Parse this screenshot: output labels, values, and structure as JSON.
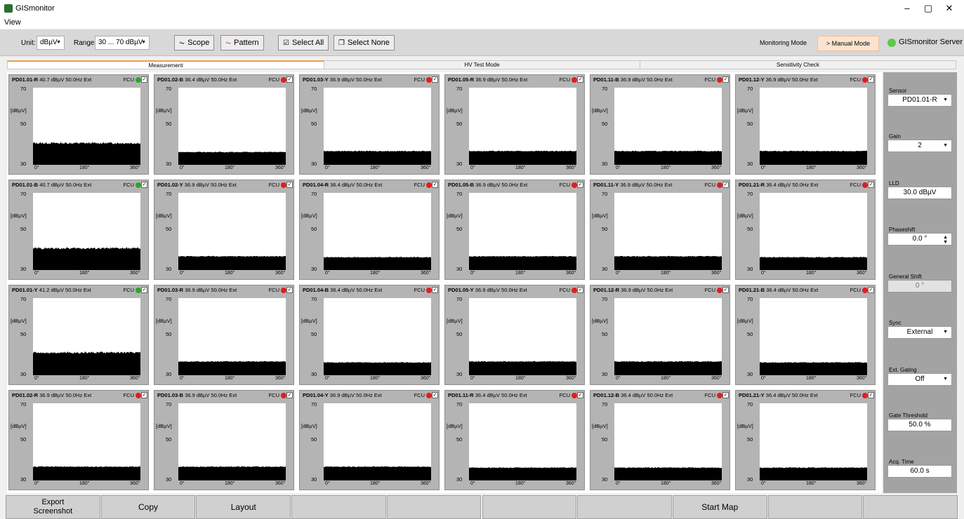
{
  "window": {
    "title": "GISmonitor",
    "minimize": "–",
    "maximize": "▢",
    "close": "✕"
  },
  "menu": {
    "view": "View"
  },
  "toolbar": {
    "unit_label": "Unit:",
    "unit_value": "dBµV",
    "range_label": "Range:",
    "range_value": "30 ... 70 dBµV",
    "scope": "Scope",
    "pattern": "Pattern",
    "select_all": "Select All",
    "select_none": "Select None",
    "monitoring_mode": "Monitoring Mode",
    "manual_mode": "> Manual Mode",
    "server": "GISmonitor Server"
  },
  "tabs": [
    "Measurement",
    "HV Test Mode",
    "Sensitivity Check"
  ],
  "plot_axis": {
    "y_max": "70",
    "y_unit": "[dBµV]",
    "y_mid": "50",
    "y_min": "30",
    "x0": "0°",
    "x1": "180°",
    "x2": "360°"
  },
  "colors": {
    "ok": "#28a828",
    "alarm": "#e01e1e"
  },
  "panels": [
    {
      "id": "PD01.01-R",
      "info": "40.7 dBµV 50.0Hz Ext",
      "fcu": "FCU",
      "status": "ok",
      "level": 40.7
    },
    {
      "id": "PD01.02-B",
      "info": "36.4 dBµV 50.0Hz Ext",
      "fcu": "FCU",
      "status": "alarm",
      "level": 36.4
    },
    {
      "id": "PD01.03-Y",
      "info": "36.9 dBµV 50.0Hz Ext",
      "fcu": "FCU",
      "status": "alarm",
      "level": 36.9
    },
    {
      "id": "PD01.05-R",
      "info": "36.9 dBµV 50.0Hz Ext",
      "fcu": "FCU",
      "status": "alarm",
      "level": 36.9
    },
    {
      "id": "PD01.11-B",
      "info": "36.9 dBµV 50.0Hz Ext",
      "fcu": "FCU",
      "status": "alarm",
      "level": 36.9
    },
    {
      "id": "PD01.12-Y",
      "info": "36.9 dBµV 50.0Hz Ext",
      "fcu": "FCU",
      "status": "alarm",
      "level": 36.9
    },
    {
      "id": "PD01.01-B",
      "info": "40.7 dBµV 50.0Hz Ext",
      "fcu": "FCU",
      "status": "ok",
      "level": 40.7
    },
    {
      "id": "PD01.02-Y",
      "info": "36.9 dBµV 50.0Hz Ext",
      "fcu": "FCU",
      "status": "alarm",
      "level": 36.9
    },
    {
      "id": "PD01.04-R",
      "info": "36.4 dBµV 50.0Hz Ext",
      "fcu": "FCU",
      "status": "alarm",
      "level": 36.4
    },
    {
      "id": "PD01.05-B",
      "info": "36.9 dBµV 50.0Hz Ext",
      "fcu": "FCU",
      "status": "alarm",
      "level": 36.9
    },
    {
      "id": "PD01.11-Y",
      "info": "36.9 dBµV 50.0Hz Ext",
      "fcu": "FCU",
      "status": "alarm",
      "level": 36.9
    },
    {
      "id": "PD01.21-R",
      "info": "36.4 dBµV 50.0Hz Ext",
      "fcu": "FCU",
      "status": "alarm",
      "level": 36.4
    },
    {
      "id": "PD01.01-Y",
      "info": "41.2 dBµV 50.0Hz Ext",
      "fcu": "FCU",
      "status": "ok",
      "level": 41.2
    },
    {
      "id": "PD01.03-R",
      "info": "36.9 dBµV 50.0Hz Ext",
      "fcu": "FCU",
      "status": "alarm",
      "level": 36.9
    },
    {
      "id": "PD01.04-B",
      "info": "36.4 dBµV 50.0Hz Ext",
      "fcu": "FCU",
      "status": "alarm",
      "level": 36.4
    },
    {
      "id": "PD01.05-Y",
      "info": "36.9 dBµV 50.0Hz Ext",
      "fcu": "FCU",
      "status": "alarm",
      "level": 36.9
    },
    {
      "id": "PD01.12-R",
      "info": "36.9 dBµV 50.0Hz Ext",
      "fcu": "FCU",
      "status": "alarm",
      "level": 36.9
    },
    {
      "id": "PD01.21-B",
      "info": "36.4 dBµV 50.0Hz Ext",
      "fcu": "FCU",
      "status": "alarm",
      "level": 36.4
    },
    {
      "id": "PD01.02-R",
      "info": "36.9 dBµV 50.0Hz Ext",
      "fcu": "FCU",
      "status": "alarm",
      "level": 36.9
    },
    {
      "id": "PD01.03-B",
      "info": "36.9 dBµV 50.0Hz Ext",
      "fcu": "FCU",
      "status": "alarm",
      "level": 36.9
    },
    {
      "id": "PD01.04-Y",
      "info": "36.9 dBµV 50.0Hz Ext",
      "fcu": "FCU",
      "status": "alarm",
      "level": 36.9
    },
    {
      "id": "PD01.11-R",
      "info": "36.4 dBµV 50.0Hz Ext",
      "fcu": "FCU",
      "status": "alarm",
      "level": 36.4
    },
    {
      "id": "PD01.12-B",
      "info": "36.4 dBµV 50.0Hz Ext",
      "fcu": "FCU",
      "status": "alarm",
      "level": 36.4
    },
    {
      "id": "PD01.21-Y",
      "info": "36.4 dBµV 50.0Hz Ext",
      "fcu": "FCU",
      "status": "alarm",
      "level": 36.4
    }
  ],
  "side": {
    "sensor_label": "Sensor",
    "sensor_value": "PD01.01-R",
    "gain_label": "Gain",
    "gain_value": "2",
    "lld_label": "LLD",
    "lld_value": "30.0 dBµV",
    "phaseshift_label": "Phaseshift",
    "phaseshift_value": "0.0 °",
    "general_shift_label": "General Shift",
    "general_shift_value": "0 °",
    "sync_label": "Sync",
    "sync_value": "External",
    "ext_gating_label": "Ext. Gating",
    "ext_gating_value": "Off",
    "gate_threshold_label": "Gate Threshold",
    "gate_threshold_value": "50.0 %",
    "acq_time_label": "Acq. Time",
    "acq_time_value": "60.0 s"
  },
  "footer": [
    "Export Screenshot",
    "Copy",
    "Layout",
    "",
    "",
    "",
    "",
    "Start Map",
    "",
    ""
  ]
}
